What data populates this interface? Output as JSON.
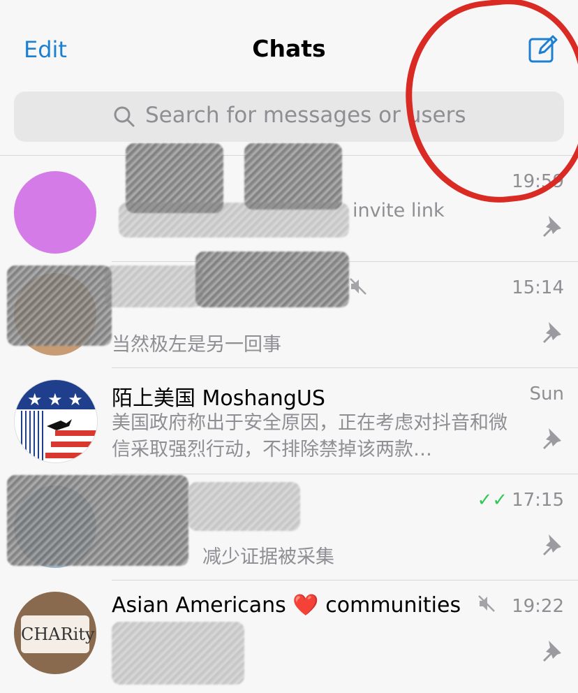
{
  "header": {
    "edit_label": "Edit",
    "title": "Chats",
    "compose_icon": "compose-icon"
  },
  "search": {
    "placeholder": "Search for messages or users"
  },
  "chats": [
    {
      "name": "",
      "time": "19:59",
      "preview": "invite link",
      "pinned": true
    },
    {
      "name": "",
      "time": "15:14",
      "preview": "当然极左是另一回事",
      "pinned": true,
      "muted": true
    },
    {
      "name": "陌上美国 MoshangUS",
      "time": "Sun",
      "preview": "美国政府称出于安全原因，正在考虑对抖音和微信采取强烈行动，不排除禁掉该两款…",
      "pinned": true
    },
    {
      "name": "",
      "time": "17:15",
      "preview": "减少证据被采集",
      "pinned": true,
      "read": true
    },
    {
      "name": "Asian Americans ❤️ communities",
      "time": "19:22",
      "preview": "",
      "pinned": true,
      "muted": true
    }
  ],
  "colors": {
    "accent": "#1d7fd1",
    "annotation": "#d92a24",
    "read_check": "#34c759"
  }
}
